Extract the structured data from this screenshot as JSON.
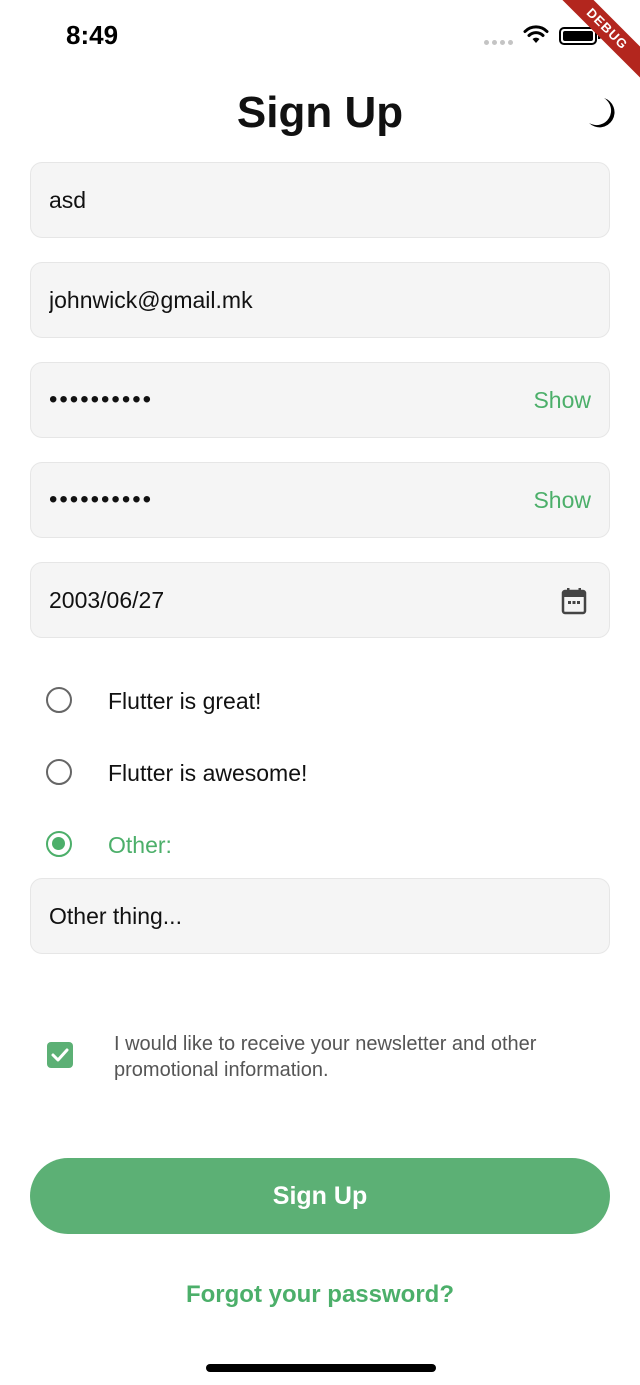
{
  "status_bar": {
    "time": "8:49"
  },
  "debug_banner": "DEBUG",
  "title": "Sign Up",
  "fields": {
    "username": {
      "value": "asd"
    },
    "email": {
      "value": "johnwick@gmail.mk"
    },
    "password": {
      "value": "••••••••••",
      "show_label": "Show"
    },
    "confirm_password": {
      "value": "••••••••••",
      "show_label": "Show"
    },
    "birthdate": {
      "value": "2003/06/27"
    },
    "other": {
      "placeholder": "Other thing..."
    }
  },
  "options": [
    {
      "label": "Flutter is great!",
      "selected": false
    },
    {
      "label": "Flutter is awesome!",
      "selected": false
    },
    {
      "label": "Other:",
      "selected": true
    }
  ],
  "newsletter": {
    "checked": true,
    "label": "I would like to receive your newsletter and other promotional information."
  },
  "signup_button": "Sign Up",
  "forgot_link": "Forgot your password?",
  "colors": {
    "accent": "#5cb075",
    "accent_text": "#4caf6a",
    "field_bg": "#f5f5f5"
  }
}
